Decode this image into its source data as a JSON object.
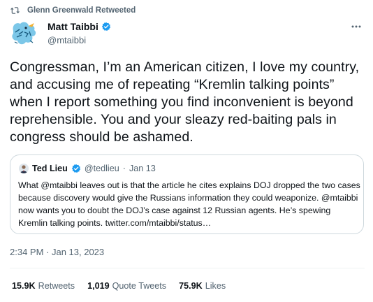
{
  "retweet_context": {
    "text": "Glenn Greenwald Retweeted",
    "icon": "retweet-icon"
  },
  "author": {
    "name": "Matt Taibbi",
    "handle": "@mtaibbi",
    "verified": true
  },
  "tweet": {
    "text": "Congressman, I’m an American citizen, I love my country, and accusing me of repeating “Kremlin talking points” when I report something you find inconvenient is beyond reprehensible. You and your sleazy red-baiting pals in congress should be ashamed."
  },
  "quoted": {
    "name": "Ted Lieu",
    "handle": "@tedlieu",
    "separator": "·",
    "date": "Jan 13",
    "verified": true,
    "text": "What @mtaibbi leaves out is that the article he cites explains DOJ dropped the two cases because discovery would give the Russians information they could weaponize. @mtaibbi now wants you to doubt the DOJ’s case against 12 Russian agents. He’s spewing Kremlin talking points. twitter.com/mtaibbi/status…"
  },
  "timestamp": "2:34 PM · Jan 13, 2023",
  "stats": {
    "retweets": {
      "count": "15.9K",
      "label": "Retweets"
    },
    "quote_tweets": {
      "count": "1,019",
      "label": "Quote Tweets"
    },
    "likes": {
      "count": "75.9K",
      "label": "Likes"
    }
  },
  "colors": {
    "verified_blue": "#1d9bf0",
    "secondary_text": "#536471",
    "border": "#cfd9de",
    "avatar_bird": "#7cc7e8"
  }
}
